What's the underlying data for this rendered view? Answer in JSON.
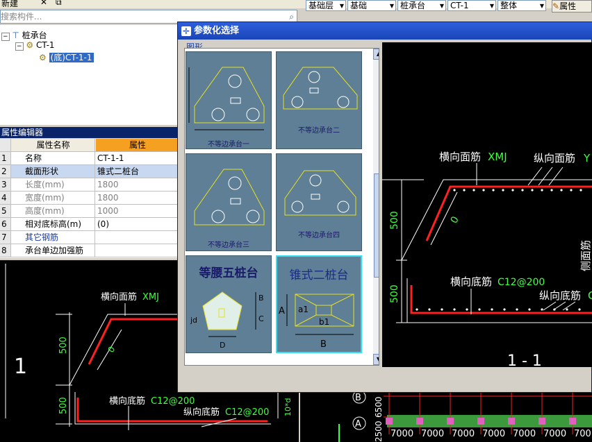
{
  "toolbar": {
    "new_label": "新建",
    "combos": [
      "基础层",
      "基础",
      "桩承台",
      "CT-1",
      "整体"
    ],
    "props_label": "属性"
  },
  "search": {
    "placeholder": "搜索构件..."
  },
  "tree": {
    "root": "桩承台",
    "child": "CT-1",
    "leaf": "(底)CT-1-1"
  },
  "property_editor": {
    "title": "属性编辑器",
    "col_name": "属性名称",
    "col_value": "属性",
    "rows": [
      {
        "n": "1",
        "k": "名称",
        "v": "CT-1-1"
      },
      {
        "n": "2",
        "k": "截面形状",
        "v": "锥式二桩台"
      },
      {
        "n": "3",
        "k": "长度(mm)",
        "v": "1800"
      },
      {
        "n": "4",
        "k": "宽度(mm)",
        "v": "1800"
      },
      {
        "n": "5",
        "k": "高度(mm)",
        "v": "1000"
      },
      {
        "n": "6",
        "k": "相对底标高(m)",
        "v": "(0)"
      },
      {
        "n": "7",
        "k": "其它钢筋",
        "v": ""
      },
      {
        "n": "8",
        "k": "承台单边加强筋",
        "v": ""
      }
    ]
  },
  "dialog": {
    "title": "参数化选择",
    "group_label": "图形",
    "thumbs": [
      {
        "caption": "不等边承台一"
      },
      {
        "caption": "不等边承台二"
      },
      {
        "caption": "不等边承台三"
      },
      {
        "caption": "不等边承台四"
      },
      {
        "caption": "等腰五桩台",
        "dims": [
          "B",
          "C",
          "D",
          "jd"
        ]
      },
      {
        "caption": "锥式二桩台",
        "dims": [
          "A",
          "a1",
          "b1",
          "B"
        ]
      }
    ]
  },
  "cad_preview": {
    "top_label": "横向面筋",
    "top_code": "XMJ",
    "side_label": "纵向面筋",
    "side_code": "Y",
    "dim1": "500",
    "dim2": "500",
    "zero": "0",
    "bottom_label": "横向底筋",
    "bottom_code": "C12@200",
    "long_bottom_label": "纵向底筋",
    "long_bottom_code": "C",
    "side_face_label": "侧面筋",
    "section_mark": "1 - 1"
  },
  "cad_main": {
    "top_label": "横向面筋",
    "top_code": "XMJ",
    "dim1": "500",
    "dim2": "500",
    "zero": "0",
    "bottom_label": "横向底筋",
    "bottom_code": "C12@200",
    "long_label": "纵向底筋",
    "long_code": "C12@200",
    "side_mark": "1",
    "side_code": "10*d"
  },
  "grid_view": {
    "axis_b": "B",
    "axis_a": "A",
    "dims": [
      "7000",
      "7000",
      "7000",
      "7000",
      "7000",
      "7000",
      "700"
    ],
    "left_dims": [
      "6500",
      "2500"
    ]
  },
  "colors": {
    "rebar": "#ff2020",
    "dim_line": "#ffffff",
    "code_green": "#40ff40",
    "thumb_bg": "#5e7f95",
    "thumb_outline": "#e8e020",
    "selection": "#316ac5"
  }
}
